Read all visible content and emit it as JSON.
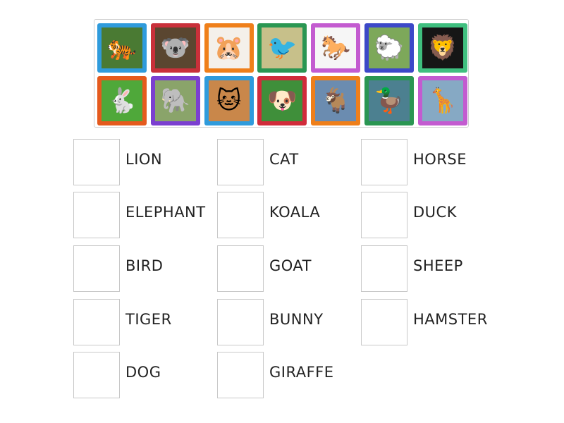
{
  "tiles": [
    {
      "icon": "tiger-photo",
      "glyph": "🐅",
      "frame": "#2f9bdc",
      "bg": "#4a7a33"
    },
    {
      "icon": "koala-photo",
      "glyph": "🐨",
      "frame": "#c9303a",
      "bg": "#5a4630"
    },
    {
      "icon": "hamster-photo",
      "glyph": "🐹",
      "frame": "#ef7f1a",
      "bg": "#f4f0ea"
    },
    {
      "icon": "bird-photo",
      "glyph": "🐦",
      "frame": "#2a9652",
      "bg": "#c7c08a"
    },
    {
      "icon": "horse-photo",
      "glyph": "🐎",
      "frame": "#c35bd0",
      "bg": "#f6f6f6"
    },
    {
      "icon": "sheep-photo",
      "glyph": "🐑",
      "frame": "#3c48c8",
      "bg": "#7da85a"
    },
    {
      "icon": "lion-photo",
      "glyph": "🦁",
      "frame": "#3fbf7f",
      "bg": "#161616"
    },
    {
      "icon": "bunny-photo",
      "glyph": "🐇",
      "frame": "#e55a1d",
      "bg": "#4fa83a"
    },
    {
      "icon": "elephant-photo",
      "glyph": "🐘",
      "frame": "#7b3fd0",
      "bg": "#8aa46a"
    },
    {
      "icon": "cat-photo",
      "glyph": "🐱",
      "frame": "#2f9bdc",
      "bg": "#c9874a"
    },
    {
      "icon": "dog-photo",
      "glyph": "🐶",
      "frame": "#d12b3a",
      "bg": "#3f8f3a"
    },
    {
      "icon": "goat-photo",
      "glyph": "🐐",
      "frame": "#ef7f1a",
      "bg": "#6b8cb0"
    },
    {
      "icon": "duck-photo",
      "glyph": "🦆",
      "frame": "#2a9652",
      "bg": "#4c8090"
    },
    {
      "icon": "giraffe-photo",
      "glyph": "🦒",
      "frame": "#c35bd0",
      "bg": "#86a9c4"
    }
  ],
  "words": [
    "LION",
    "CAT",
    "HORSE",
    "ELEPHANT",
    "KOALA",
    "DUCK",
    "BIRD",
    "GOAT",
    "SHEEP",
    "TIGER",
    "BUNNY",
    "HAMSTER",
    "DOG",
    "GIRAFFE"
  ]
}
